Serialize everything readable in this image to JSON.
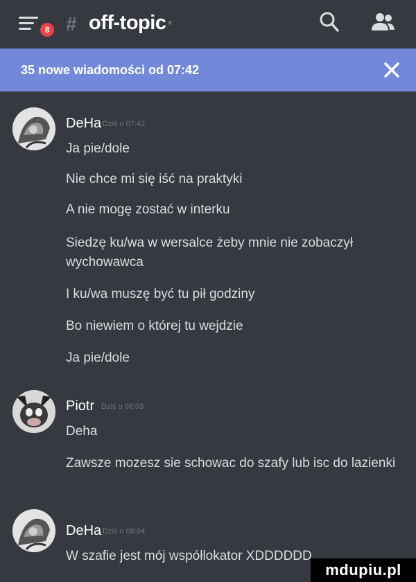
{
  "header": {
    "notification_count": "8",
    "hash_symbol": "#",
    "channel_name": "off-topic",
    "caret_symbol": "▾",
    "search_icon": "search-icon",
    "members_icon": "members-icon"
  },
  "banner": {
    "text": "35 nowe wiadomości od 07:42",
    "close_icon": "close-icon"
  },
  "messages": [
    {
      "author": "DeHa",
      "timestamp": "Dziś o 07:42",
      "lines": [
        "Ja pie/dole",
        "Nie chce mi się iść na praktyki",
        "A nie mogę zostać w interku",
        "Siedzę ku/wa w wersalce żeby mnie nie zobaczył wychowawca",
        "I ku/wa muszę być tu pił godziny",
        "Bo niewiem o której tu wejdzie",
        "Ja pie/dole"
      ]
    },
    {
      "author": "Piotr",
      "timestamp": "Dziś o 08:03",
      "lines": [
        "Deha",
        "Zawsze mozesz sie schowac do szafy lub isc do lazienki"
      ]
    },
    {
      "author": "DeHa",
      "timestamp": "Dziś o 08:04",
      "lines": [
        "W szafie jest mój współlokator XDDDDDD"
      ]
    }
  ],
  "watermark": "mdupiu.pl",
  "colors": {
    "background": "#36393f",
    "banner": "#7289da",
    "badge": "#ed4245",
    "text": "#dcddde",
    "muted": "#72767d"
  }
}
